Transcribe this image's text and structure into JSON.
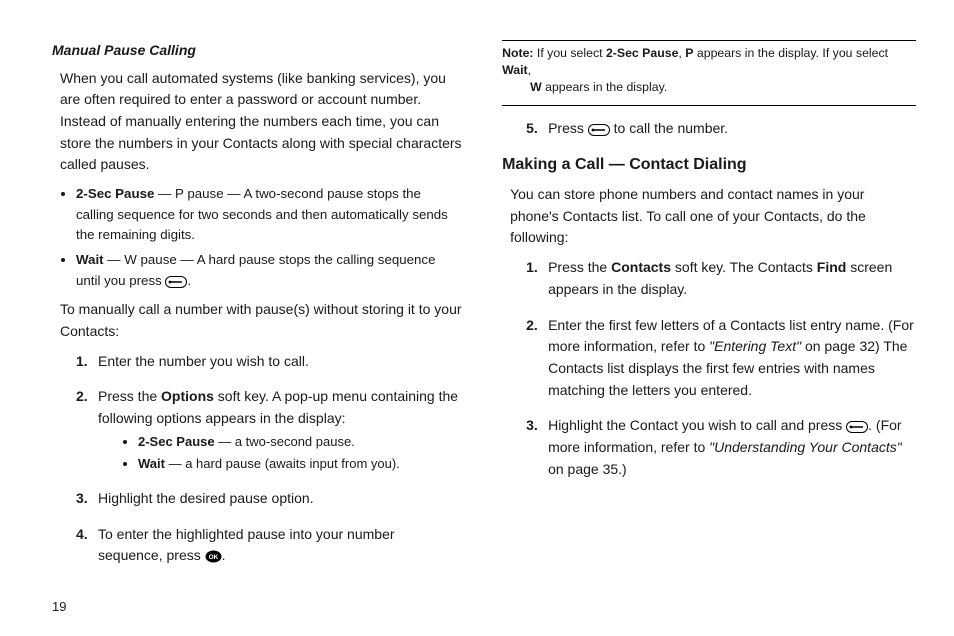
{
  "page_number": "19",
  "left": {
    "heading": "Manual Pause Calling",
    "intro": "When you call automated systems (like banking services), you are often required to enter a password or account number. Instead of manually entering the numbers each time, you can store the numbers in your Contacts along with special characters called pauses.",
    "bullets": {
      "b1_label": "2-Sec Pause",
      "b1_rest": " — P pause — A two-second pause stops the calling sequence for two seconds and then automatically sends the remaining digits.",
      "b2_label": "Wait",
      "b2_rest_a": " — W pause — A hard pause stops the calling sequence until you press ",
      "b2_rest_b": "."
    },
    "lead": "To manually call a number with pause(s) without storing it to your Contacts:",
    "steps": {
      "s1": "Enter the number you wish to call.",
      "s2_a": "Press the ",
      "s2_b": "Options",
      "s2_c": " soft key. A pop-up menu containing the following options appears in the display:",
      "sub1_label": "2-Sec Pause",
      "sub1_rest": " — a two-second pause.",
      "sub2_label": "Wait",
      "sub2_rest": " — a hard pause (awaits input from you).",
      "s3": "Highlight the desired pause option.",
      "s4_a": "To enter the highlighted pause into your number sequence, press ",
      "s4_b": "."
    }
  },
  "right": {
    "note": {
      "label": "Note:",
      "a": " If you select ",
      "b": "2-Sec Pause",
      "c": ", ",
      "d": "P",
      "e": " appears in the display. If you select ",
      "f": "Wait",
      "g": ",",
      "line2_a": "W",
      "line2_b": " appears in the display."
    },
    "step5_a": "Press ",
    "step5_b": " to call the number.",
    "heading": "Making a Call — Contact Dialing",
    "intro": "You can store phone numbers and contact names in your phone's Contacts list. To call one of your Contacts, do the following:",
    "steps": {
      "s1_a": "Press the ",
      "s1_b": "Contacts",
      "s1_c": " soft key. The Contacts ",
      "s1_d": "Find",
      "s1_e": " screen appears in the display.",
      "s2_a": "Enter the first few letters of a Contacts list entry name. (For more information, refer to ",
      "s2_ref": "\"Entering Text\"",
      "s2_b": " on page 32) The Contacts list displays the first few entries with names matching the letters you entered.",
      "s3_a": "Highlight the Contact you wish to call and press ",
      "s3_b": ". (For more information, refer to ",
      "s3_ref": "\"Understanding Your Contacts\"",
      "s3_c": " on page 35.)"
    }
  },
  "icons": {
    "send": "send-key-icon",
    "ok": "ok-key-icon"
  }
}
